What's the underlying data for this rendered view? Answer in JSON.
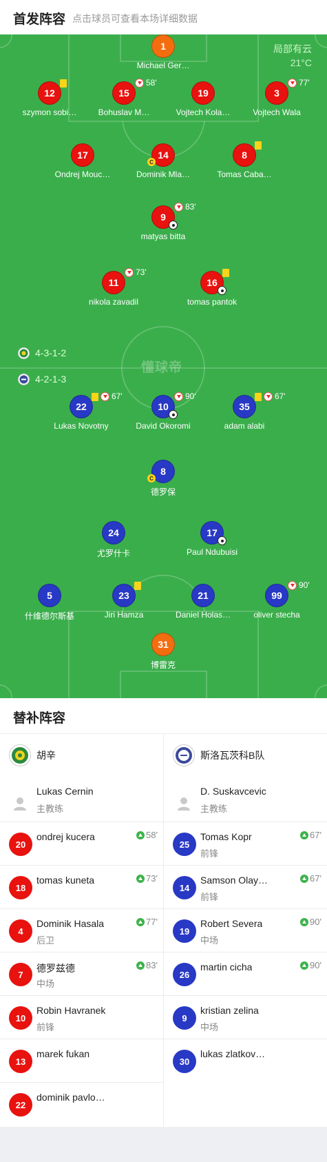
{
  "header": {
    "title": "首发阵容",
    "hint": "点击球员可查看本场详细数据"
  },
  "weather": {
    "condition": "局部有云",
    "temp": "21°C"
  },
  "watermark": "懂球帝",
  "home_formation": "4-3-1-2",
  "away_formation": "4-2-1-3",
  "home_players": [
    {
      "num": "1",
      "name": "Michael Ger…",
      "color": "orange"
    },
    {
      "num": "12",
      "name": "szymon sobi…",
      "yellow": true
    },
    {
      "num": "15",
      "name": "Bohuslav M…",
      "sub": "58'"
    },
    {
      "num": "19",
      "name": "Vojtech Kola…"
    },
    {
      "num": "3",
      "name": "Vojtech Wala",
      "sub": "77'"
    },
    {
      "num": "17",
      "name": "Ondrej Mouc…"
    },
    {
      "num": "14",
      "name": "Dominik Mla…",
      "captain": "C"
    },
    {
      "num": "8",
      "name": "Tomas Caba…",
      "yellow": true
    },
    {
      "num": "9",
      "name": "matyas bitta",
      "sub": "83'",
      "goal": true
    },
    {
      "num": "11",
      "name": "nikola zavadil",
      "sub": "73'"
    },
    {
      "num": "16",
      "name": "tomas pantok",
      "yellow": true,
      "goal": true
    }
  ],
  "away_players": [
    {
      "num": "22",
      "name": "Lukas Novotny",
      "yellow": true,
      "sub": "67'"
    },
    {
      "num": "10",
      "name": "David Okoromi",
      "sub": "90'",
      "goal": true
    },
    {
      "num": "35",
      "name": "adam alabi",
      "yellow": true,
      "sub": "67'"
    },
    {
      "num": "8",
      "name": "德罗保",
      "captain": "C"
    },
    {
      "num": "24",
      "name": "尤罗什卡"
    },
    {
      "num": "17",
      "name": "Paul Ndubuisi",
      "goal": true
    },
    {
      "num": "5",
      "name": "什维德尔斯基"
    },
    {
      "num": "23",
      "name": "Jiri Hamza",
      "yellow": true
    },
    {
      "num": "21",
      "name": "Daniel Holas…"
    },
    {
      "num": "99",
      "name": "oliver stecha",
      "sub": "90'"
    },
    {
      "num": "31",
      "name": "博雷克",
      "color": "orange"
    }
  ],
  "subs": {
    "title": "替补阵容",
    "home": {
      "team": "胡辛",
      "coach": {
        "name": "Lukas Cernin",
        "role": "主教练"
      },
      "players": [
        {
          "num": "20",
          "name": "ondrej kucera",
          "pos": "",
          "in": "58'"
        },
        {
          "num": "18",
          "name": "tomas kuneta",
          "pos": "",
          "in": "73'"
        },
        {
          "num": "4",
          "name": "Dominik Hasala",
          "pos": "后卫",
          "in": "77'"
        },
        {
          "num": "7",
          "name": "德罗兹德",
          "pos": "中场",
          "in": "83'"
        },
        {
          "num": "10",
          "name": "Robin Havranek",
          "pos": "前锋",
          "in": ""
        },
        {
          "num": "13",
          "name": "marek fukan",
          "pos": "",
          "in": ""
        },
        {
          "num": "22",
          "name": "dominik pavlo…",
          "pos": "",
          "in": ""
        }
      ]
    },
    "away": {
      "team": "斯洛瓦茨科B队",
      "coach": {
        "name": "D. Suskavcevic",
        "role": "主教练"
      },
      "players": [
        {
          "num": "25",
          "name": "Tomas Kopr",
          "pos": "前锋",
          "in": "67'"
        },
        {
          "num": "14",
          "name": "Samson Olay…",
          "pos": "前锋",
          "in": "67'"
        },
        {
          "num": "19",
          "name": "Robert Severa",
          "pos": "中场",
          "in": "90'"
        },
        {
          "num": "26",
          "name": "martin cicha",
          "pos": "",
          "in": "90'"
        },
        {
          "num": "9",
          "name": "kristian zelina",
          "pos": "中场",
          "in": ""
        },
        {
          "num": "30",
          "name": "lukas zlatkov…",
          "pos": "",
          "in": ""
        }
      ]
    }
  }
}
